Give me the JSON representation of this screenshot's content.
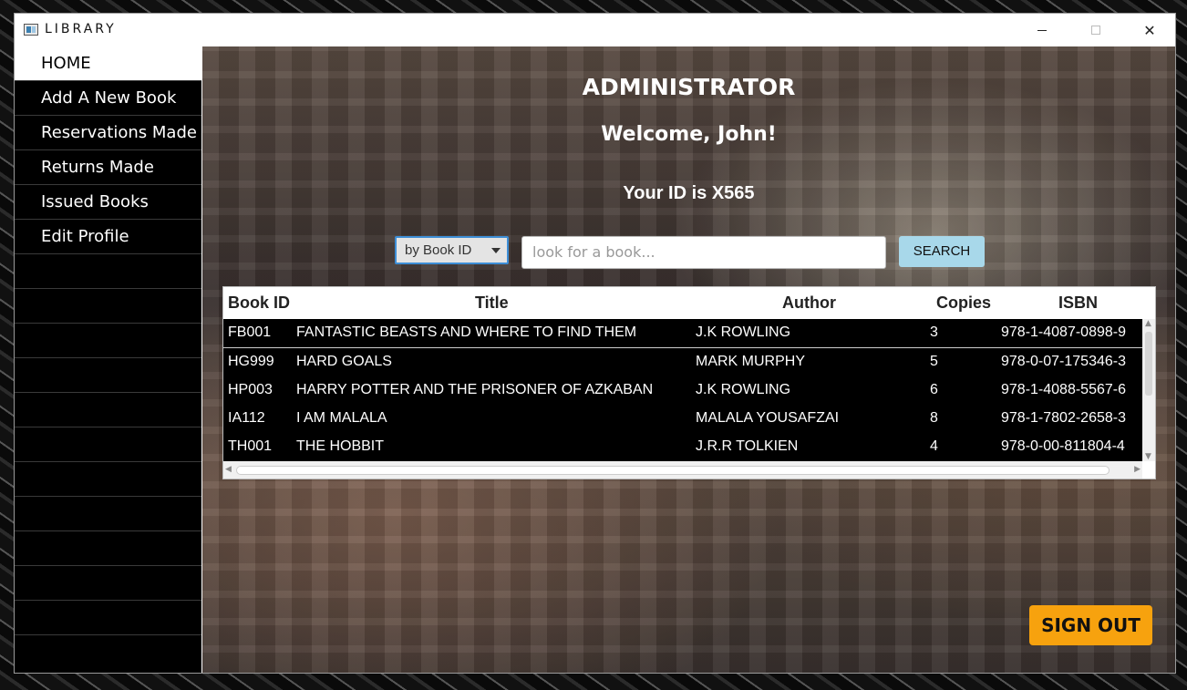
{
  "window": {
    "title": "LIBRARY"
  },
  "sidebar": {
    "items": [
      {
        "label": "HOME",
        "active": true
      },
      {
        "label": "Add A New Book"
      },
      {
        "label": "Reservations Made"
      },
      {
        "label": "Returns Made"
      },
      {
        "label": "Issued Books"
      },
      {
        "label": "Edit Profile"
      }
    ]
  },
  "header": {
    "role": "ADMINISTRATOR",
    "welcome": "Welcome, John!",
    "id_text": "Your ID is X565"
  },
  "search": {
    "filter_selected": "by Book ID",
    "placeholder": "look for a book...",
    "button_label": "SEARCH"
  },
  "table": {
    "columns": [
      "Book ID",
      "Title",
      "Author",
      "Copies",
      "ISBN"
    ],
    "rows": [
      [
        "FB001",
        "FANTASTIC BEASTS AND WHERE TO FIND THEM",
        "J.K ROWLING",
        "3",
        "978-1-4087-0898-9"
      ],
      [
        "HG999",
        "HARD GOALS",
        "MARK MURPHY",
        "5",
        "978-0-07-175346-3"
      ],
      [
        "HP003",
        "HARRY POTTER AND THE PRISONER OF AZKABAN",
        "J.K ROWLING",
        "6",
        "978-1-4088-5567-6"
      ],
      [
        "IA112",
        "I AM MALALA",
        "MALALA YOUSAFZAI",
        "8",
        "978-1-7802-2658-3"
      ],
      [
        "TH001",
        "THE HOBBIT",
        "J.R.R TOLKIEN",
        "4",
        "978-0-00-811804-4"
      ]
    ]
  },
  "actions": {
    "signout_label": "SIGN OUT"
  },
  "colors": {
    "signout": "#f7a20e",
    "search_button": "#a8d8ea",
    "sidebar": "#000000"
  }
}
